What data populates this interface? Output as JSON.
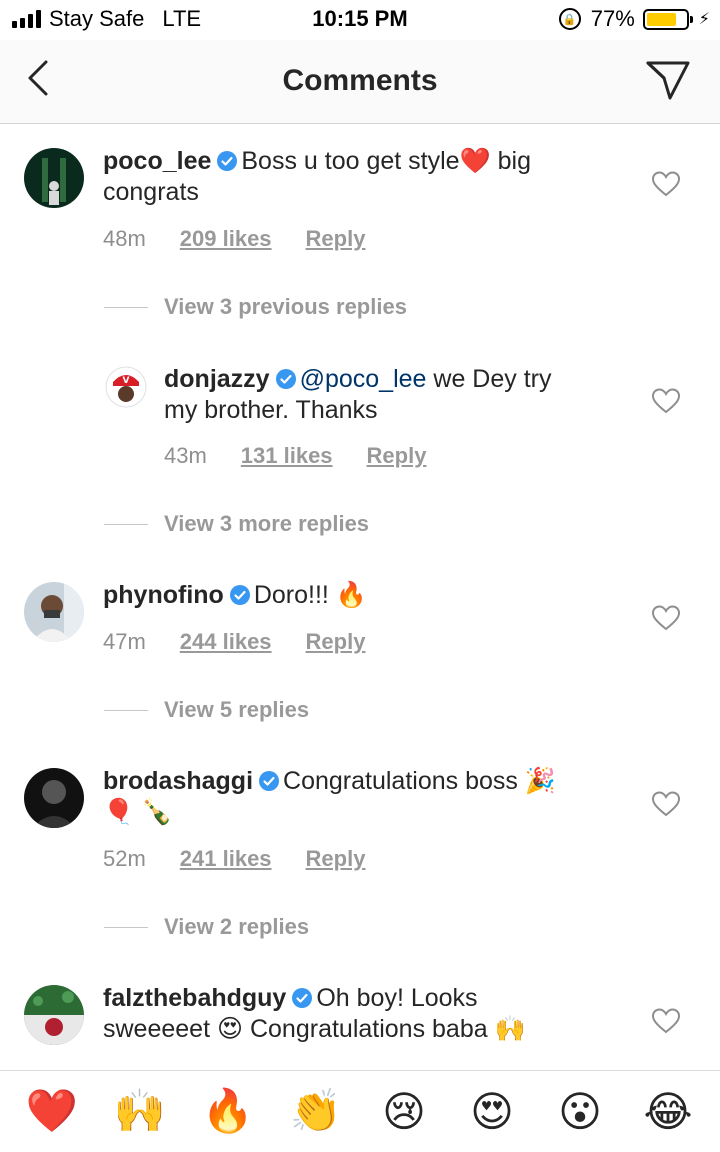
{
  "status": {
    "carrier": "Stay Safe",
    "network": "LTE",
    "time": "10:15 PM",
    "battery_pct": "77%",
    "battery_level": 0.77,
    "battery_color": "#ffcc00"
  },
  "nav": {
    "title": "Comments"
  },
  "comments": [
    {
      "username": "poco_lee",
      "text_main": "Boss u too get style❤️ big",
      "text_cont": "congrats",
      "time": "48m",
      "likes": "209 likes",
      "reply": "Reply",
      "view_text": "View 3 previous replies",
      "avatar_colors": [
        "#0b2a1e",
        "#2f6b3f"
      ]
    },
    {
      "username": "donjazzy",
      "mention": "@poco_lee",
      "text_main": " we Dey try",
      "text_cont": "my brother. Thanks",
      "time": "43m",
      "likes": "131 likes",
      "reply": "Reply",
      "view_text": "View 3 more replies",
      "avatar_colors": [
        "#ffffff",
        "#d81f26"
      ]
    },
    {
      "username": "phynofino",
      "text_main": "Doro!!! 🔥",
      "time": "47m",
      "likes": "244 likes",
      "reply": "Reply",
      "view_text": "View 5 replies",
      "avatar_colors": [
        "#c9d3dc",
        "#3a3a3a"
      ]
    },
    {
      "username": "brodashaggi",
      "text_main": "Congratulations boss 🎉",
      "text_cont": "🎈 🍾",
      "time": "52m",
      "likes": "241 likes",
      "reply": "Reply",
      "view_text": "View 2 replies",
      "avatar_colors": [
        "#111111",
        "#555555"
      ]
    },
    {
      "username": "falzthebahdguy",
      "text_main": "Oh boy! Looks",
      "text_cont": "sweeeeet 😍 Congratulations baba 🙌",
      "avatar_colors": [
        "#2d6b34",
        "#b02030"
      ]
    }
  ],
  "emoji_bar": [
    {
      "name": "red-heart",
      "glyph": "❤️"
    },
    {
      "name": "raising-hands",
      "glyph": "🙌"
    },
    {
      "name": "fire",
      "glyph": "🔥"
    },
    {
      "name": "clapping-hands",
      "glyph": "👏"
    },
    {
      "name": "crying-face",
      "glyph": "😢"
    },
    {
      "name": "heart-eyes",
      "glyph": "😍"
    },
    {
      "name": "astonished-face",
      "glyph": "😮"
    },
    {
      "name": "tears-of-joy",
      "glyph": "😂"
    }
  ],
  "colors": {
    "verified_blue": "#3897f0",
    "text_primary": "#262626",
    "text_secondary": "#8e8e8e"
  }
}
